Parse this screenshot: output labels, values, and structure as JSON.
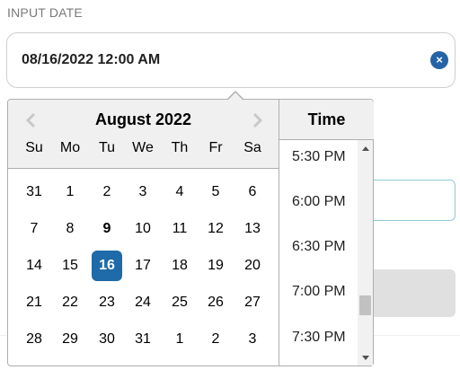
{
  "field": {
    "label": "INPUT DATE",
    "value": "08/16/2022 12:00 AM",
    "clear_icon": "×"
  },
  "calendar": {
    "month_title": "August 2022",
    "weekdays": [
      "Su",
      "Mo",
      "Tu",
      "We",
      "Th",
      "Fr",
      "Sa"
    ],
    "weeks": [
      [
        "31",
        "1",
        "2",
        "3",
        "4",
        "5",
        "6"
      ],
      [
        "7",
        "8",
        "9",
        "10",
        "11",
        "12",
        "13"
      ],
      [
        "14",
        "15",
        "16",
        "17",
        "18",
        "19",
        "20"
      ],
      [
        "21",
        "22",
        "23",
        "24",
        "25",
        "26",
        "27"
      ],
      [
        "28",
        "29",
        "30",
        "31",
        "1",
        "2",
        "3"
      ]
    ],
    "selected_day": "16",
    "today_day": "9",
    "selected_color": "#1f6aa8"
  },
  "time": {
    "title": "Time",
    "items": [
      "5:30 PM",
      "6:00 PM",
      "6:30 PM",
      "7:00 PM",
      "7:30 PM"
    ]
  },
  "icons": {
    "prev": "chevron-left-icon",
    "next": "chevron-right-icon",
    "clear": "clear-icon"
  }
}
